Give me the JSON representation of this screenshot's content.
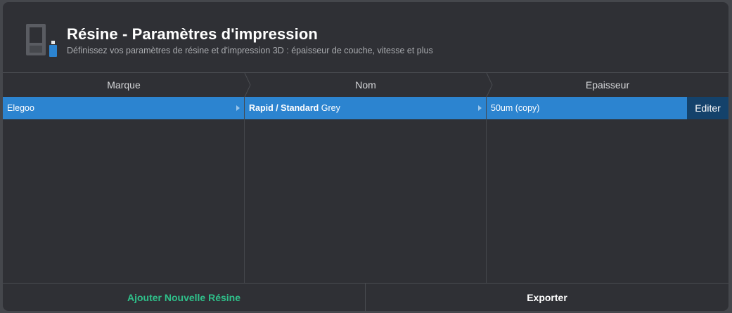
{
  "header": {
    "title": "Résine - Paramètres d'impression",
    "subtitle": "Définissez vos paramètres de résine et d'impression 3D : épaisseur de couche, vitesse et plus",
    "icon": "resin-printer-icon"
  },
  "columns": {
    "brand": "Marque",
    "name": "Nom",
    "thickness": "Epaisseur"
  },
  "brands": {
    "selected": "Elegoo"
  },
  "names": {
    "selected_bold": "Rapid / Standard",
    "selected_rest": " Grey"
  },
  "thicknesses": {
    "selected": "50um (copy)",
    "edit_label": "Editer"
  },
  "footer": {
    "add_label": "Ajouter Nouvelle Résine",
    "export_label": "Exporter"
  },
  "colors": {
    "accent_blue": "#2c84d0",
    "edit_button": "#14426b",
    "add_green": "#2fc08a",
    "background": "#2f3035"
  }
}
